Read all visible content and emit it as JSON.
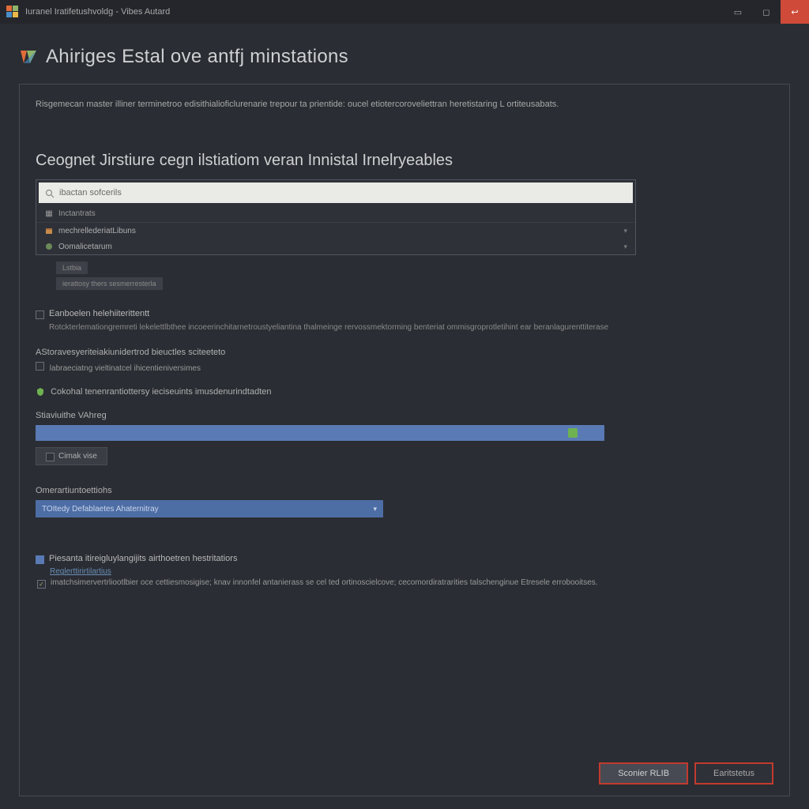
{
  "titlebar": {
    "text": "Iuranel Iratifetushvoldg - Vibes Autard"
  },
  "page": {
    "title": "Ahiriges Estal ove antfj minstations"
  },
  "panel": {
    "description": "Risgemecan master illiner terminetroo edisithialioficlurenarie trepour ta prientide: oucel etiotercoroveliettran heretistaring L ortiteusabats.",
    "section_title": "Ceognet Jirstiure cegn ilstiatiom veran Innistal Irnelryeables"
  },
  "listbox": {
    "search_placeholder": "ibactan sofcerils",
    "header": "Inctantrats",
    "items": [
      {
        "label": "mechrellederiatLibuns"
      },
      {
        "label": "Oomalicetarum"
      }
    ]
  },
  "sub": {
    "badge1": "Lstbia",
    "badge2": "ierattosy thers sesmerresterla",
    "check1_label": "Eanboelen helehiiterittentt",
    "check1_desc": "Rotckterlemationgremreti lekelettlbthee incoeerinchitarnetroustyeliantina thalmeinge rervossmektorming benteriat ommisgroprotletihint ear beranlagurenttiterase",
    "line1": "AStoravesyeriteiakiunidertrod bieuctles sciteeteto",
    "line2": "labraeciatng vieltinatcel ihicentieniversimes",
    "line3": "Cokohal tenenrantiottersy ieciseuints imusdenurindtadten"
  },
  "progress": {
    "label": "Stiaviuithe VAhreg",
    "button": "Cimak vise"
  },
  "dropdown": {
    "label": "Omerartiuntoettiohs",
    "selected": "TOItedy Defablaetes Ahaternitray"
  },
  "bottom": {
    "check_label": "Piesanta itireigluylangijits airthoetren hestritatiors",
    "link": "Reglerttirirtilartius",
    "note": "imatchsimervertrliootlbier oce cettiesmosigise; knav innonfel antanierass se cel ted ortinoscielcove; cecomordiratrarities talschenginue Etresele errobooitses."
  },
  "footer": {
    "primary": "Sconier RLIB",
    "secondary": "Earitstetus"
  }
}
